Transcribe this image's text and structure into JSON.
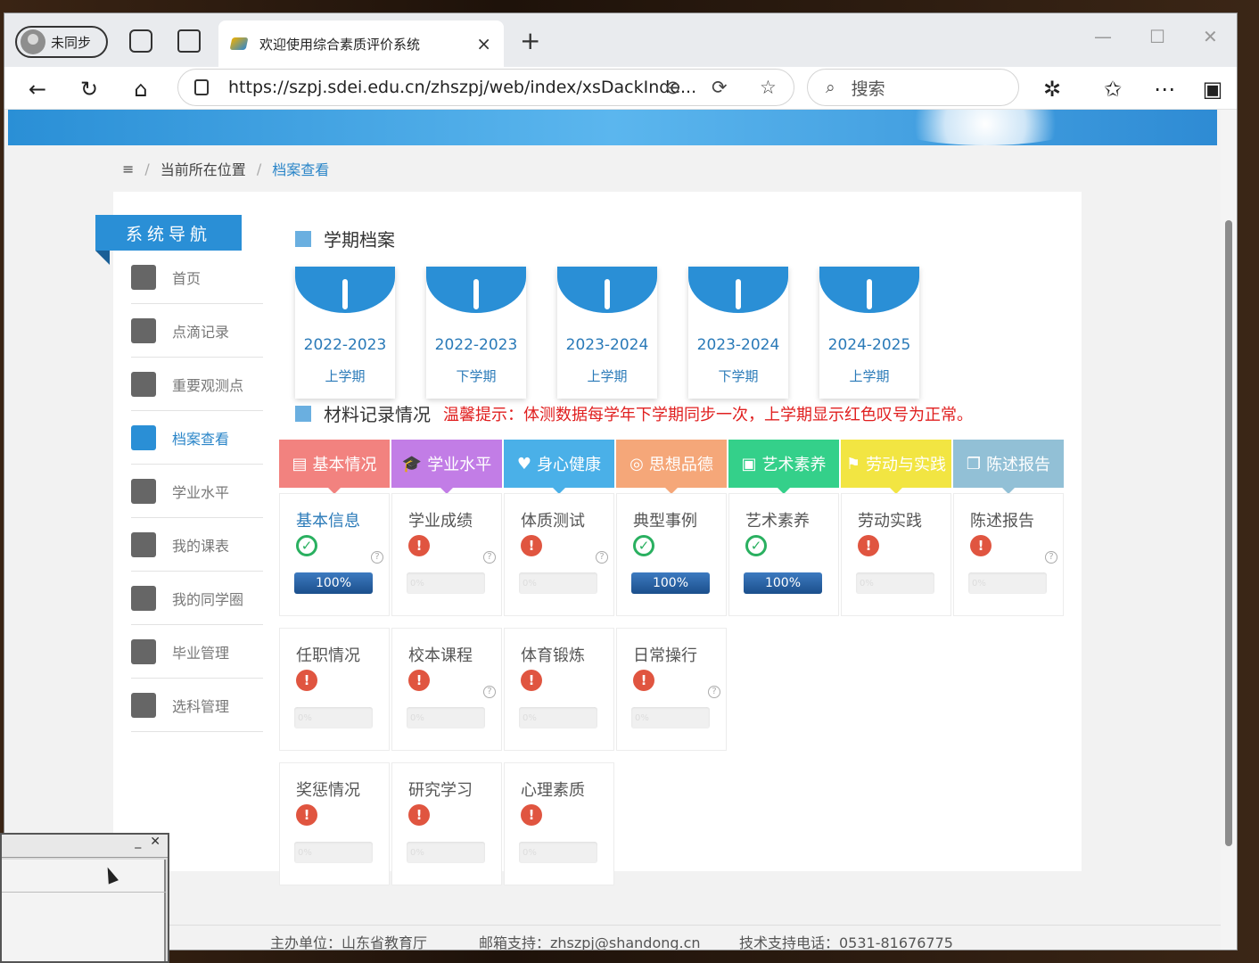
{
  "browser": {
    "profile_label": "未同步",
    "tab_title": "欢迎使用综合素质评价系统",
    "tab_close": "×",
    "new_tab": "+",
    "min": "—",
    "max": "☐",
    "close": "✕",
    "url": "https://szpj.sdei.edu.cn/zhszpj/web/index/xsDackInde...",
    "search_placeholder": "搜索"
  },
  "breadcrumb": {
    "menu": "≡",
    "sep": "/",
    "location": "当前所在位置",
    "current": "档案查看"
  },
  "nav": {
    "title": "系统导航",
    "items": [
      {
        "label": "首页",
        "icon": "home-icon"
      },
      {
        "label": "点滴记录",
        "icon": "edit-icon"
      },
      {
        "label": "重要观测点",
        "icon": "exchange-icon"
      },
      {
        "label": "档案查看",
        "icon": "archive-icon"
      },
      {
        "label": "学业水平",
        "icon": "edit-icon"
      },
      {
        "label": "我的课表",
        "icon": "exchange-icon"
      },
      {
        "label": "我的同学圈",
        "icon": "users-icon"
      },
      {
        "label": "毕业管理",
        "icon": "users-icon"
      },
      {
        "label": "选科管理",
        "icon": "clipboard-check-icon"
      }
    ]
  },
  "semester_section": {
    "title": "学期档案"
  },
  "semesters": [
    {
      "year": "2022-2023",
      "term": "上学期"
    },
    {
      "year": "2022-2023",
      "term": "下学期"
    },
    {
      "year": "2023-2024",
      "term": "上学期"
    },
    {
      "year": "2023-2024",
      "term": "下学期"
    },
    {
      "year": "2024-2025",
      "term": "上学期"
    }
  ],
  "material_section": {
    "title": "材料记录情况",
    "tip": "温馨提示：体测数据每学年下学期同步一次，上学期显示红色叹号为正常。"
  },
  "categories": [
    {
      "label": "基本情况",
      "icon": "▤",
      "color": "#f2827f"
    },
    {
      "label": "学业水平",
      "icon": "🎓",
      "color": "#c27de6"
    },
    {
      "label": "身心健康",
      "icon": "♥",
      "color": "#4ab0e8"
    },
    {
      "label": "思想品德",
      "icon": "◎",
      "color": "#f5a779"
    },
    {
      "label": "艺术素养",
      "icon": "▣",
      "color": "#34d08a"
    },
    {
      "label": "劳动与实践",
      "icon": "⚑",
      "color": "#f2e542"
    },
    {
      "label": "陈述报告",
      "icon": "❐",
      "color": "#92c0d6"
    }
  ],
  "cards": [
    {
      "title": "基本信息",
      "status": "ok",
      "progress": 100,
      "progress_label": "100%",
      "help": true
    },
    {
      "title": "学业成绩",
      "status": "bad",
      "progress": 0,
      "progress_label": "0%",
      "help": true
    },
    {
      "title": "体质测试",
      "status": "bad",
      "progress": 0,
      "progress_label": "0%",
      "help": true
    },
    {
      "title": "典型事例",
      "status": "ok",
      "progress": 100,
      "progress_label": "100%",
      "help": false
    },
    {
      "title": "艺术素养",
      "status": "ok",
      "progress": 100,
      "progress_label": "100%",
      "help": false
    },
    {
      "title": "劳动实践",
      "status": "bad",
      "progress": 0,
      "progress_label": "0%",
      "help": false
    },
    {
      "title": "陈述报告",
      "status": "bad",
      "progress": 0,
      "progress_label": "0%",
      "help": true
    },
    {
      "title": "任职情况",
      "status": "bad",
      "progress": 0,
      "progress_label": "0%",
      "help": false
    },
    {
      "title": "校本课程",
      "status": "bad",
      "progress": 0,
      "progress_label": "0%",
      "help": true
    },
    {
      "title": "体育锻炼",
      "status": "bad",
      "progress": 0,
      "progress_label": "0%",
      "help": false
    },
    {
      "title": "日常操行",
      "status": "bad",
      "progress": 0,
      "progress_label": "0%",
      "help": true
    },
    {
      "title": "奖惩情况",
      "status": "bad",
      "progress": 0,
      "progress_label": "0%",
      "help": false
    },
    {
      "title": "研究学习",
      "status": "bad",
      "progress": 0,
      "progress_label": "0%",
      "help": false
    },
    {
      "title": "心理素质",
      "status": "bad",
      "progress": 0,
      "progress_label": "0%",
      "help": false
    }
  ],
  "footer": {
    "host": "主办单位：山东省教育厅",
    "email": "邮箱支持：zhszpj@shandong.cn",
    "phone": "技术支持电话：0531-81676775"
  },
  "mini_window": {
    "min": "_",
    "close": "✕"
  }
}
